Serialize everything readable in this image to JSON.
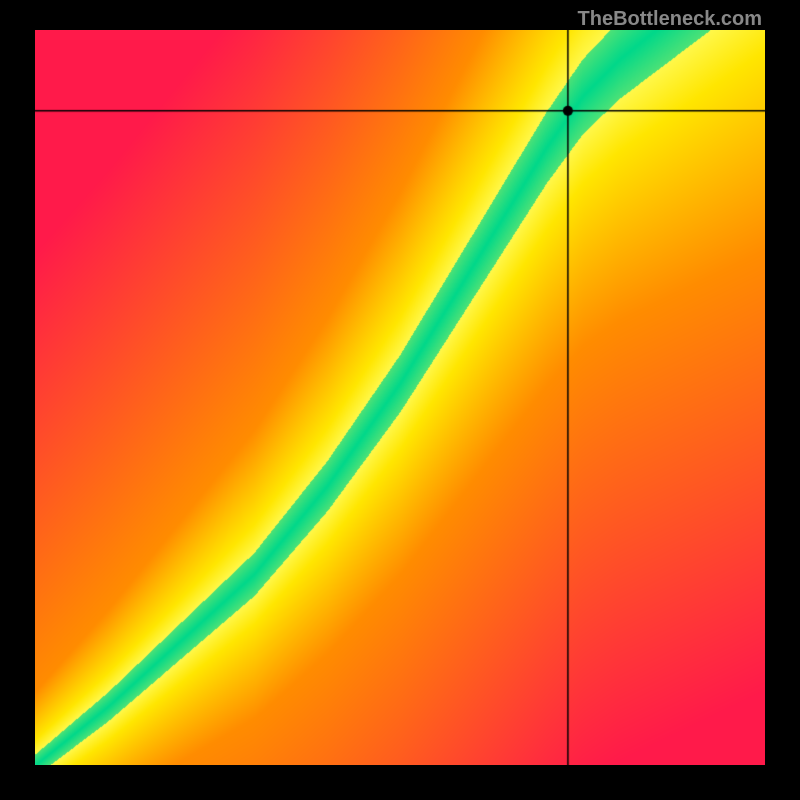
{
  "watermark": "TheBottleneck.com",
  "chart_data": {
    "type": "heatmap",
    "title": "",
    "xlabel": "",
    "ylabel": "",
    "xlim": [
      0,
      100
    ],
    "ylim": [
      0,
      100
    ],
    "crosshair": {
      "x": 73,
      "y": 89
    },
    "ridge_path": [
      {
        "x": 0,
        "y": 0
      },
      {
        "x": 10,
        "y": 8
      },
      {
        "x": 20,
        "y": 17
      },
      {
        "x": 30,
        "y": 26
      },
      {
        "x": 40,
        "y": 38
      },
      {
        "x": 50,
        "y": 52
      },
      {
        "x": 55,
        "y": 60
      },
      {
        "x": 60,
        "y": 68
      },
      {
        "x": 65,
        "y": 76
      },
      {
        "x": 70,
        "y": 84
      },
      {
        "x": 75,
        "y": 91
      },
      {
        "x": 80,
        "y": 96
      },
      {
        "x": 85,
        "y": 100
      }
    ],
    "ridge_width_base": 2.5,
    "color_stops": {
      "far": "#ff1a4a",
      "mid": "#ff8c00",
      "near": "#ffe600",
      "close": "#fff84a",
      "center": "#00d88a"
    },
    "grid": false,
    "legend": false
  }
}
